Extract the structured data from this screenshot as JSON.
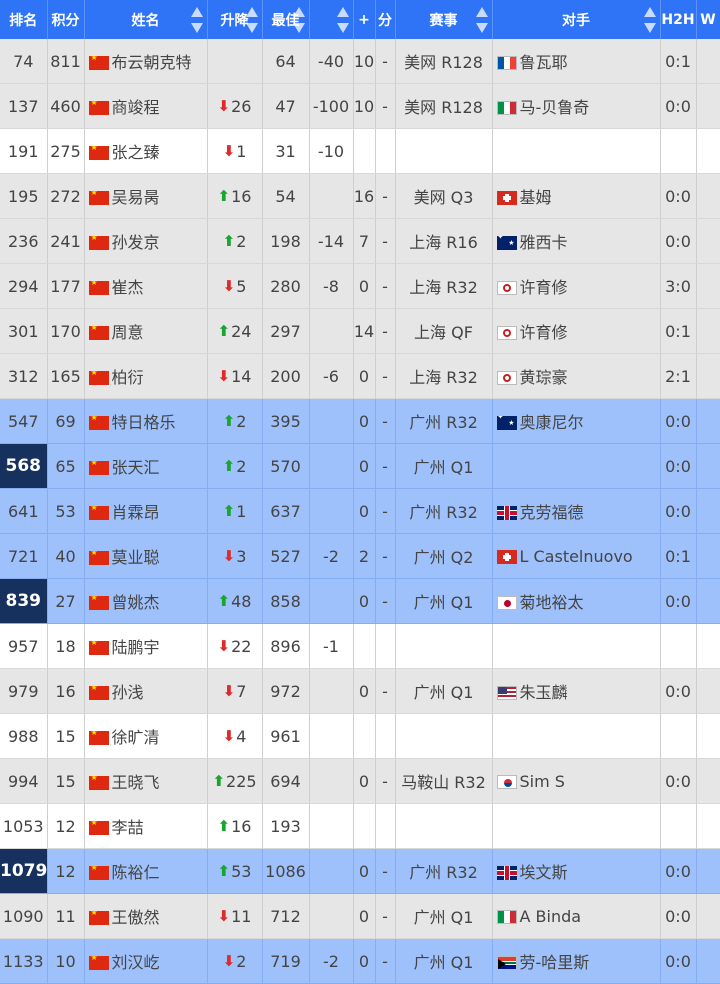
{
  "headers": {
    "rank": "排名",
    "points": "积分",
    "name": "姓名",
    "change": "升降",
    "best": "最佳",
    "diff": "",
    "pts_a": "+",
    "pts_b": "分",
    "tournament": "赛事",
    "opponent": "对手",
    "h2h": "H2H",
    "w": "W"
  },
  "colors": {
    "header_bg": "#2f74f6",
    "row_gray": "#e6e6e6",
    "row_blue": "#9ec1fc",
    "rank_highlight": "#17315e",
    "arrow_up": "#19a530",
    "arrow_down": "#e02a2a"
  },
  "rows": [
    {
      "rank": "74",
      "points": "811",
      "flag": "cn",
      "name": "布云朝克特",
      "dir": "",
      "chg": "",
      "best": "64",
      "diff": "-40",
      "p1": "10",
      "p2": "-",
      "tour": "美网 R128",
      "opp_flag": "fr",
      "opp": "鲁瓦耶",
      "h2h": "0:1",
      "style": "gray",
      "hl": false
    },
    {
      "rank": "137",
      "points": "460",
      "flag": "cn",
      "name": "商竣程",
      "dir": "down",
      "chg": "26",
      "best": "47",
      "diff": "-100",
      "p1": "10",
      "p2": "-",
      "tour": "美网 R128",
      "opp_flag": "it",
      "opp": "马-贝鲁奇",
      "h2h": "0:0",
      "style": "gray",
      "hl": false
    },
    {
      "rank": "191",
      "points": "275",
      "flag": "cn",
      "name": "张之臻",
      "dir": "down",
      "chg": "1",
      "best": "31",
      "diff": "-10",
      "p1": "",
      "p2": "",
      "tour": "",
      "opp_flag": "",
      "opp": "",
      "h2h": "",
      "style": "white",
      "hl": false
    },
    {
      "rank": "195",
      "points": "272",
      "flag": "cn",
      "name": "吴易昺",
      "dir": "up",
      "chg": "16",
      "best": "54",
      "diff": "",
      "p1": "16",
      "p2": "-",
      "tour": "美网 Q3",
      "opp_flag": "ch",
      "opp": "基姆",
      "h2h": "0:0",
      "style": "gray",
      "hl": false
    },
    {
      "rank": "236",
      "points": "241",
      "flag": "cn",
      "name": "孙发京",
      "dir": "up",
      "chg": "2",
      "best": "198",
      "diff": "-14",
      "p1": "7",
      "p2": "-",
      "tour": "上海 R16",
      "opp_flag": "au",
      "opp": "雅西卡",
      "h2h": "0:0",
      "style": "gray",
      "hl": false
    },
    {
      "rank": "294",
      "points": "177",
      "flag": "cn",
      "name": "崔杰",
      "dir": "down",
      "chg": "5",
      "best": "280",
      "diff": "-8",
      "p1": "0",
      "p2": "-",
      "tour": "上海 R32",
      "opp_flag": "tw",
      "opp": "许育修",
      "h2h": "3:0",
      "style": "gray",
      "hl": false
    },
    {
      "rank": "301",
      "points": "170",
      "flag": "cn",
      "name": "周意",
      "dir": "up",
      "chg": "24",
      "best": "297",
      "diff": "",
      "p1": "14",
      "p2": "-",
      "tour": "上海 QF",
      "opp_flag": "tw",
      "opp": "许育修",
      "h2h": "0:1",
      "style": "gray",
      "hl": false
    },
    {
      "rank": "312",
      "points": "165",
      "flag": "cn",
      "name": "柏衍",
      "dir": "down",
      "chg": "14",
      "best": "200",
      "diff": "-6",
      "p1": "0",
      "p2": "-",
      "tour": "上海 R32",
      "opp_flag": "tw",
      "opp": "黄琮豪",
      "h2h": "2:1",
      "style": "gray",
      "hl": false
    },
    {
      "rank": "547",
      "points": "69",
      "flag": "cn",
      "name": "特日格乐",
      "dir": "up",
      "chg": "2",
      "best": "395",
      "diff": "",
      "p1": "0",
      "p2": "-",
      "tour": "广州 R32",
      "opp_flag": "au",
      "opp": "奥康尼尔",
      "h2h": "0:0",
      "style": "blue",
      "hl": false
    },
    {
      "rank": "568",
      "points": "65",
      "flag": "cn",
      "name": "张天汇",
      "dir": "up",
      "chg": "2",
      "best": "570",
      "diff": "",
      "p1": "0",
      "p2": "-",
      "tour": "广州 Q1",
      "opp_flag": "",
      "opp": "",
      "h2h": "0:0",
      "style": "blue",
      "hl": true
    },
    {
      "rank": "641",
      "points": "53",
      "flag": "cn",
      "name": "肖霖昂",
      "dir": "up",
      "chg": "1",
      "best": "637",
      "diff": "",
      "p1": "0",
      "p2": "-",
      "tour": "广州 R32",
      "opp_flag": "gb",
      "opp": "克劳福德",
      "h2h": "0:0",
      "style": "blue",
      "hl": false
    },
    {
      "rank": "721",
      "points": "40",
      "flag": "cn",
      "name": "莫业聪",
      "dir": "down",
      "chg": "3",
      "best": "527",
      "diff": "-2",
      "p1": "2",
      "p2": "-",
      "tour": "广州 Q2",
      "opp_flag": "ch",
      "opp": "L Castelnuovo",
      "h2h": "0:1",
      "style": "blue",
      "hl": false
    },
    {
      "rank": "839",
      "points": "27",
      "flag": "cn",
      "name": "曾姚杰",
      "dir": "up",
      "chg": "48",
      "best": "858",
      "diff": "",
      "p1": "0",
      "p2": "-",
      "tour": "广州 Q1",
      "opp_flag": "jp",
      "opp": "菊地裕太",
      "h2h": "0:0",
      "style": "blue",
      "hl": true
    },
    {
      "rank": "957",
      "points": "18",
      "flag": "cn",
      "name": "陆鹏宇",
      "dir": "down",
      "chg": "22",
      "best": "896",
      "diff": "-1",
      "p1": "",
      "p2": "",
      "tour": "",
      "opp_flag": "",
      "opp": "",
      "h2h": "",
      "style": "white",
      "hl": false
    },
    {
      "rank": "979",
      "points": "16",
      "flag": "cn",
      "name": "孙浅",
      "dir": "down",
      "chg": "7",
      "best": "972",
      "diff": "",
      "p1": "0",
      "p2": "-",
      "tour": "广州 Q1",
      "opp_flag": "us",
      "opp": "朱玉麟",
      "h2h": "0:0",
      "style": "gray",
      "hl": false
    },
    {
      "rank": "988",
      "points": "15",
      "flag": "cn",
      "name": "徐旷清",
      "dir": "down",
      "chg": "4",
      "best": "961",
      "diff": "",
      "p1": "",
      "p2": "",
      "tour": "",
      "opp_flag": "",
      "opp": "",
      "h2h": "",
      "style": "white",
      "hl": false
    },
    {
      "rank": "994",
      "points": "15",
      "flag": "cn",
      "name": "王晓飞",
      "dir": "up",
      "chg": "225",
      "best": "694",
      "diff": "",
      "p1": "0",
      "p2": "-",
      "tour": "马鞍山 R32",
      "opp_flag": "kr",
      "opp": "Sim S",
      "h2h": "0:0",
      "style": "gray",
      "hl": false
    },
    {
      "rank": "1053",
      "points": "12",
      "flag": "cn",
      "name": "李喆",
      "dir": "up",
      "chg": "16",
      "best": "193",
      "diff": "",
      "p1": "",
      "p2": "",
      "tour": "",
      "opp_flag": "",
      "opp": "",
      "h2h": "",
      "style": "white",
      "hl": false
    },
    {
      "rank": "1079",
      "points": "12",
      "flag": "cn",
      "name": "陈裕仁",
      "dir": "up",
      "chg": "53",
      "best": "1086",
      "diff": "",
      "p1": "0",
      "p2": "-",
      "tour": "广州 R32",
      "opp_flag": "gb",
      "opp": "埃文斯",
      "h2h": "0:0",
      "style": "blue",
      "hl": true
    },
    {
      "rank": "1090",
      "points": "11",
      "flag": "cn",
      "name": "王傲然",
      "dir": "down",
      "chg": "11",
      "best": "712",
      "diff": "",
      "p1": "0",
      "p2": "-",
      "tour": "广州 Q1",
      "opp_flag": "it",
      "opp": "A Binda",
      "h2h": "0:0",
      "style": "gray",
      "hl": false
    },
    {
      "rank": "1133",
      "points": "10",
      "flag": "cn",
      "name": "刘汉屹",
      "dir": "down",
      "chg": "2",
      "best": "719",
      "diff": "-2",
      "p1": "0",
      "p2": "-",
      "tour": "广州 Q1",
      "opp_flag": "za",
      "opp": "劳-哈里斯",
      "h2h": "0:0",
      "style": "blue",
      "hl": false
    }
  ]
}
